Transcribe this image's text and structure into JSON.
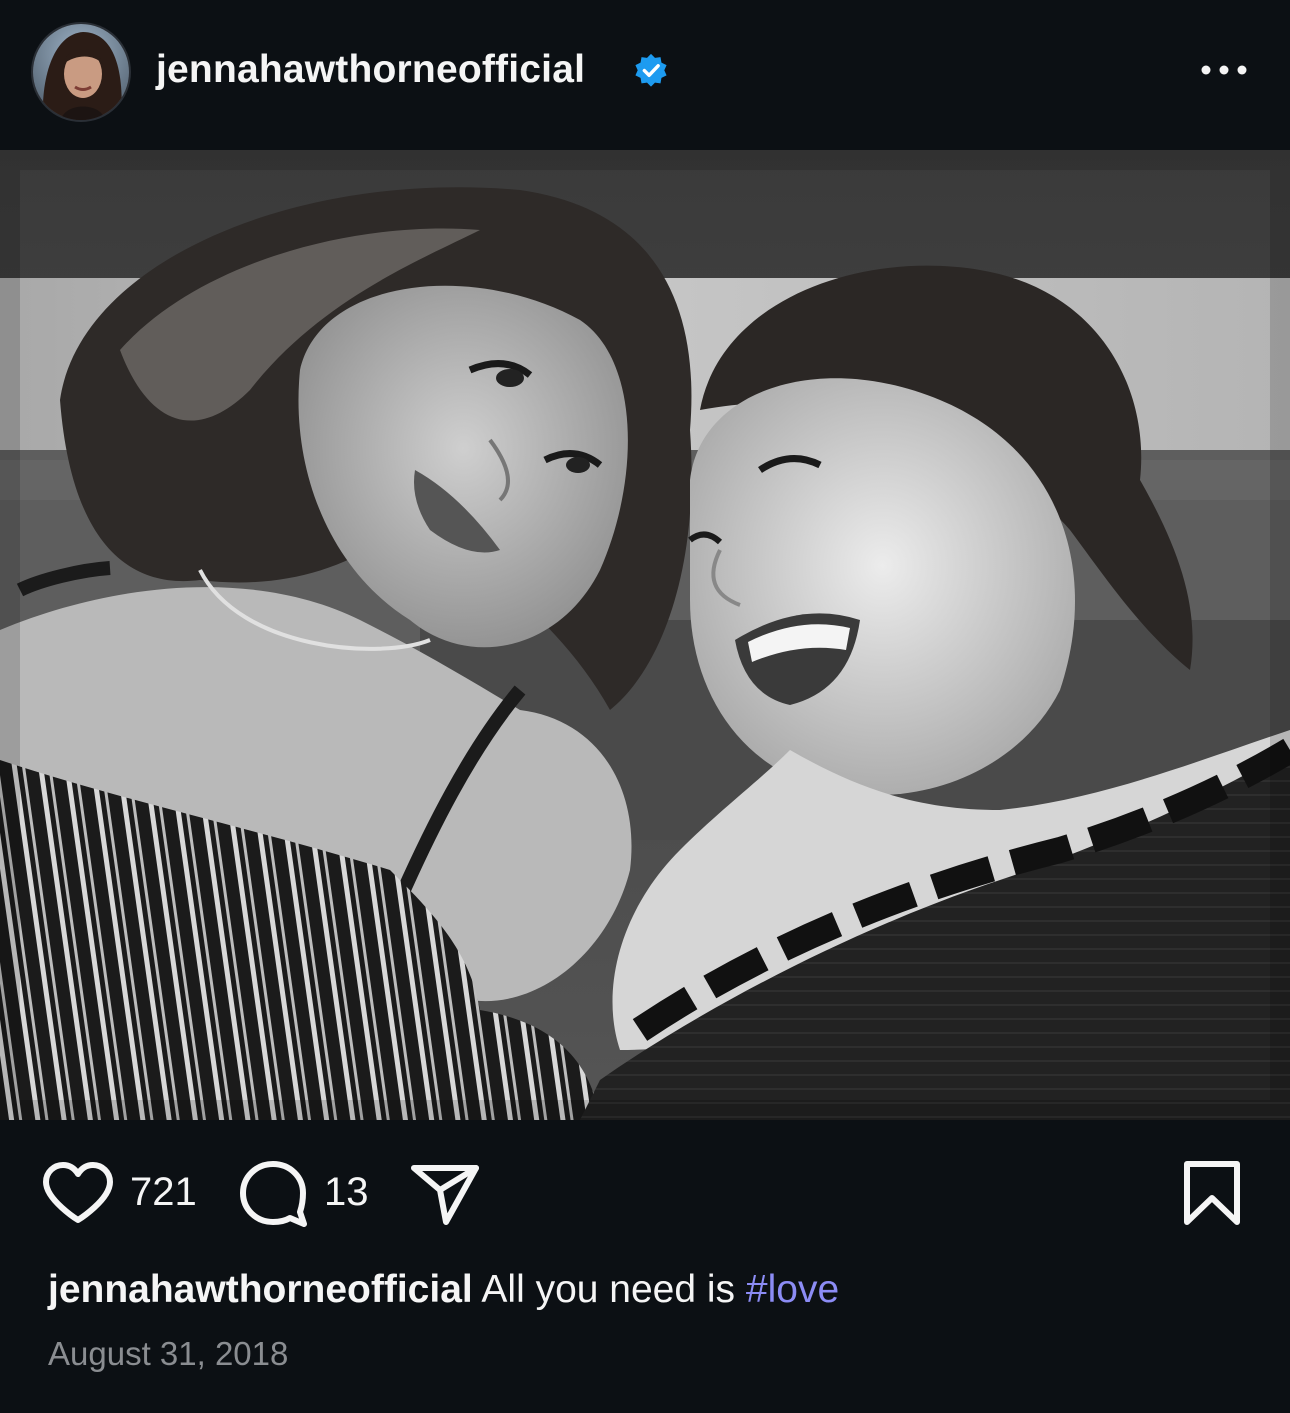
{
  "post": {
    "username": "jennahawthorneofficial",
    "verified": true,
    "more_icon": "more-horizontal-icon",
    "photo": {
      "description_style": "black-and-white selfie of two women lying side by side"
    },
    "likes": "721",
    "comments": "13",
    "caption": {
      "username": "jennahawthorneofficial",
      "text": "All you need is ",
      "hashtag": "#love"
    },
    "date": "August 31, 2018"
  },
  "colors": {
    "background": "#0c1014",
    "text": "#f5f5f5",
    "verified_badge": "#1d9bf0",
    "hashtag": "#8c8cf5",
    "date": "#8a8d91"
  },
  "icons": [
    "heart-icon",
    "comment-icon",
    "share-icon",
    "bookmark-icon",
    "verified-badge-icon",
    "more-horizontal-icon"
  ]
}
